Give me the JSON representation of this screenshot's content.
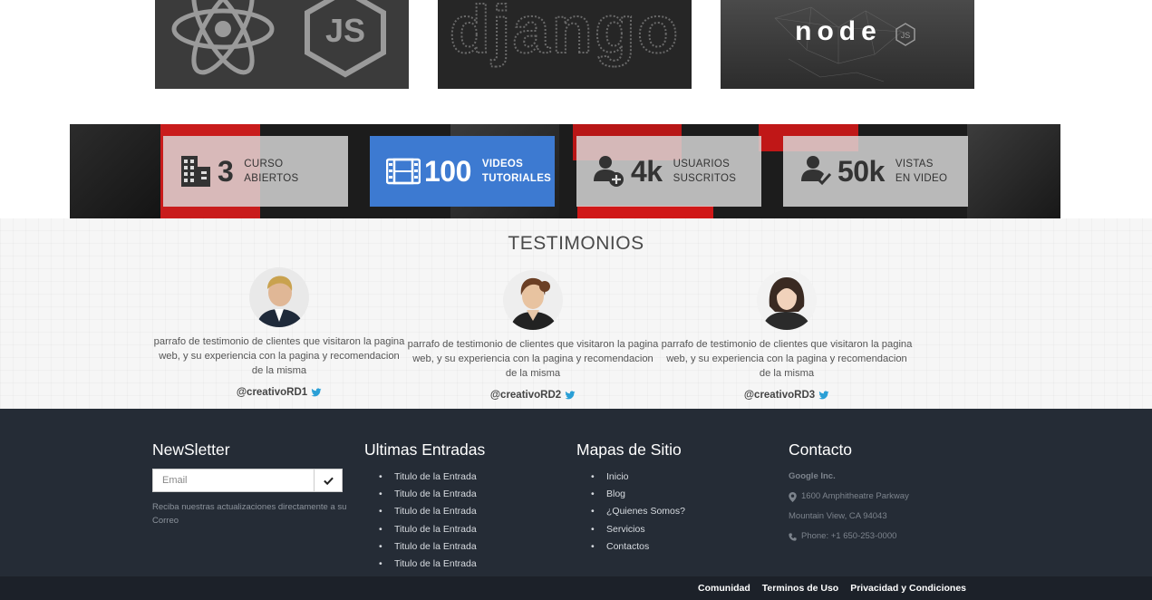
{
  "tech_cards": [
    {
      "name": "React + JS",
      "logo_text": "JS"
    },
    {
      "name": "Django",
      "logo_text": "django"
    },
    {
      "name": "Node JS",
      "logo_text": "node",
      "logo_sub": "JS"
    }
  ],
  "stats": [
    {
      "icon": "building-icon",
      "number": "3",
      "line1": "CURSO",
      "line2": "ABIERTOS",
      "active": false
    },
    {
      "icon": "film-icon",
      "number": "100",
      "line1": "VIDEOS",
      "line2": "TUTORIALES",
      "active": true
    },
    {
      "icon": "user-add-icon",
      "number": "4k",
      "line1": "USUARIOS",
      "line2": "SUSCRITOS",
      "active": false
    },
    {
      "icon": "user-check-icon",
      "number": "50k",
      "line1": "VISTAS",
      "line2": "EN VIDEO",
      "active": false
    }
  ],
  "testimonials": {
    "title": "TESTIMONIOS",
    "items": [
      {
        "text": "parrafo de testimonio de clientes que visitaron la pagina web, y su experiencia con la pagina y recomendacion de la misma",
        "handle": "@creativoRD1"
      },
      {
        "text": "parrafo de testimonio de clientes que visitaron la pagina web, y su experiencia con la pagina y recomendacion de la misma",
        "handle": "@creativoRD2"
      },
      {
        "text": "parrafo de testimonio de clientes que visitaron la pagina web, y su experiencia con la pagina y recomendacion de la misma",
        "handle": "@creativoRD3"
      }
    ]
  },
  "footer": {
    "newsletter": {
      "title": "NewSletter",
      "placeholder": "Email",
      "description": "Reciba nuestras actualizaciones directamente a su Correo"
    },
    "latest": {
      "title": "Ultimas Entradas",
      "items": [
        "Titulo de la Entrada",
        "Titulo de la Entrada",
        "Titulo de la Entrada",
        "Titulo de la Entrada",
        "Titulo de la Entrada",
        "Titulo de la Entrada"
      ]
    },
    "sitemap": {
      "title": "Mapas de Sitio",
      "items": [
        "Inicio",
        "Blog",
        "¿Quienes Somos?",
        "Servicios",
        "Contactos"
      ]
    },
    "contact": {
      "title": "Contacto",
      "company": "Google Inc.",
      "address1": "1600 Amphitheatre Parkway",
      "address2": "Mountain View, CA 94043",
      "phone": "Phone: +1 650-253-0000"
    },
    "bottom_links": [
      "Comunidad",
      "Terminos de Uso",
      "Privacidad y Condiciones"
    ]
  },
  "colors": {
    "accent_blue": "#3d7ad1",
    "footer_bg": "#252c36",
    "bottom_bar_bg": "#1c2129",
    "twitter_blue": "#2a9fd6"
  }
}
